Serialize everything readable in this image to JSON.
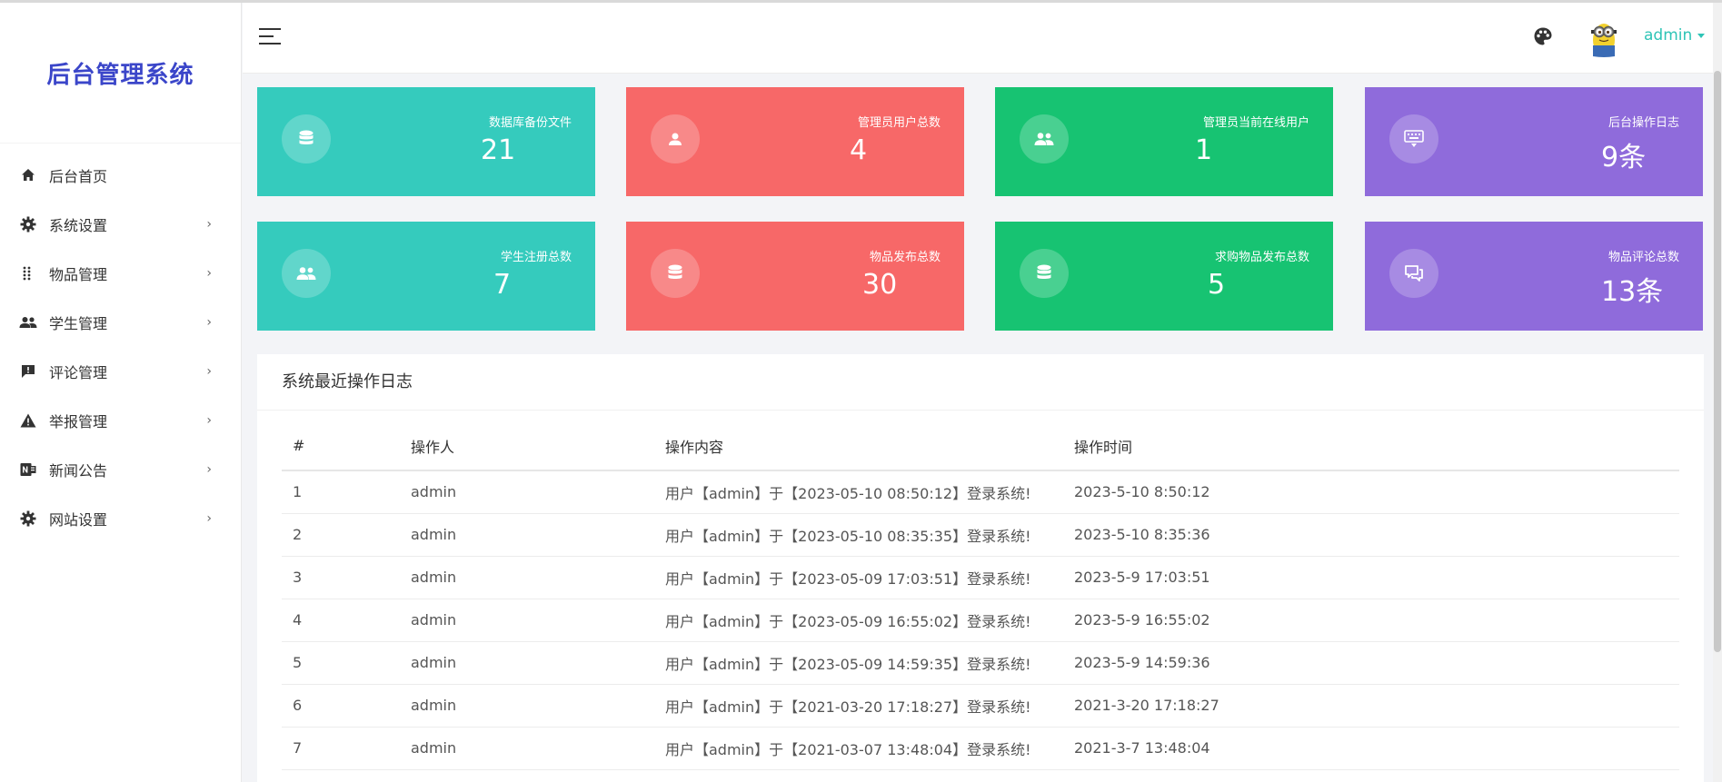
{
  "sidebar": {
    "brand": "后台管理系统",
    "items": [
      {
        "label": "后台首页",
        "icon": "home-icon",
        "arrow": ""
      },
      {
        "label": "系统设置",
        "icon": "gear-icon",
        "arrow": "›"
      },
      {
        "label": "物品管理",
        "icon": "grid-dots-icon",
        "arrow": "›"
      },
      {
        "label": "学生管理",
        "icon": "users-icon",
        "arrow": "›"
      },
      {
        "label": "评论管理",
        "icon": "comment-alert-icon",
        "arrow": "›"
      },
      {
        "label": "举报管理",
        "icon": "warning-icon",
        "arrow": "›"
      },
      {
        "label": "新闻公告",
        "icon": "news-icon",
        "arrow": "›"
      },
      {
        "label": "网站设置",
        "icon": "gear-icon",
        "arrow": "›"
      }
    ]
  },
  "header": {
    "user": "admin"
  },
  "cards": [
    {
      "label": "数据库备份文件",
      "value": "21",
      "icon": "database-icon",
      "color": "#35cbbd"
    },
    {
      "label": "管理员用户总数",
      "value": "4",
      "icon": "user-icon",
      "color": "#f76868"
    },
    {
      "label": "管理员当前在线用户",
      "value": "1",
      "icon": "users-icon",
      "color": "#17c372"
    },
    {
      "label": "后台操作日志",
      "value": "9条",
      "icon": "keyboard-icon",
      "color": "#8f6bdb"
    },
    {
      "label": "学生注册总数",
      "value": "7",
      "icon": "users-icon",
      "color": "#35cbbd"
    },
    {
      "label": "物品发布总数",
      "value": "30",
      "icon": "database-icon",
      "color": "#f76868"
    },
    {
      "label": "求购物品发布总数",
      "value": "5",
      "icon": "database-icon",
      "color": "#17c372"
    },
    {
      "label": "物品评论总数",
      "value": "13条",
      "icon": "chat-icon",
      "color": "#8f6bdb"
    }
  ],
  "log": {
    "title": "系统最近操作日志",
    "headers": [
      "#",
      "操作人",
      "操作内容",
      "操作时间"
    ],
    "rows": [
      [
        "1",
        "admin",
        "用户【admin】于【2023-05-10 08:50:12】登录系统!",
        "2023-5-10 8:50:12"
      ],
      [
        "2",
        "admin",
        "用户【admin】于【2023-05-10 08:35:35】登录系统!",
        "2023-5-10 8:35:36"
      ],
      [
        "3",
        "admin",
        "用户【admin】于【2023-05-09 17:03:51】登录系统!",
        "2023-5-9 17:03:51"
      ],
      [
        "4",
        "admin",
        "用户【admin】于【2023-05-09 16:55:02】登录系统!",
        "2023-5-9 16:55:02"
      ],
      [
        "5",
        "admin",
        "用户【admin】于【2023-05-09 14:59:35】登录系统!",
        "2023-5-9 14:59:36"
      ],
      [
        "6",
        "admin",
        "用户【admin】于【2021-03-20 17:18:27】登录系统!",
        "2021-3-20 17:18:27"
      ],
      [
        "7",
        "admin",
        "用户【admin】于【2021-03-07 13:48:04】登录系统!",
        "2021-3-7 13:48:04"
      ]
    ]
  }
}
